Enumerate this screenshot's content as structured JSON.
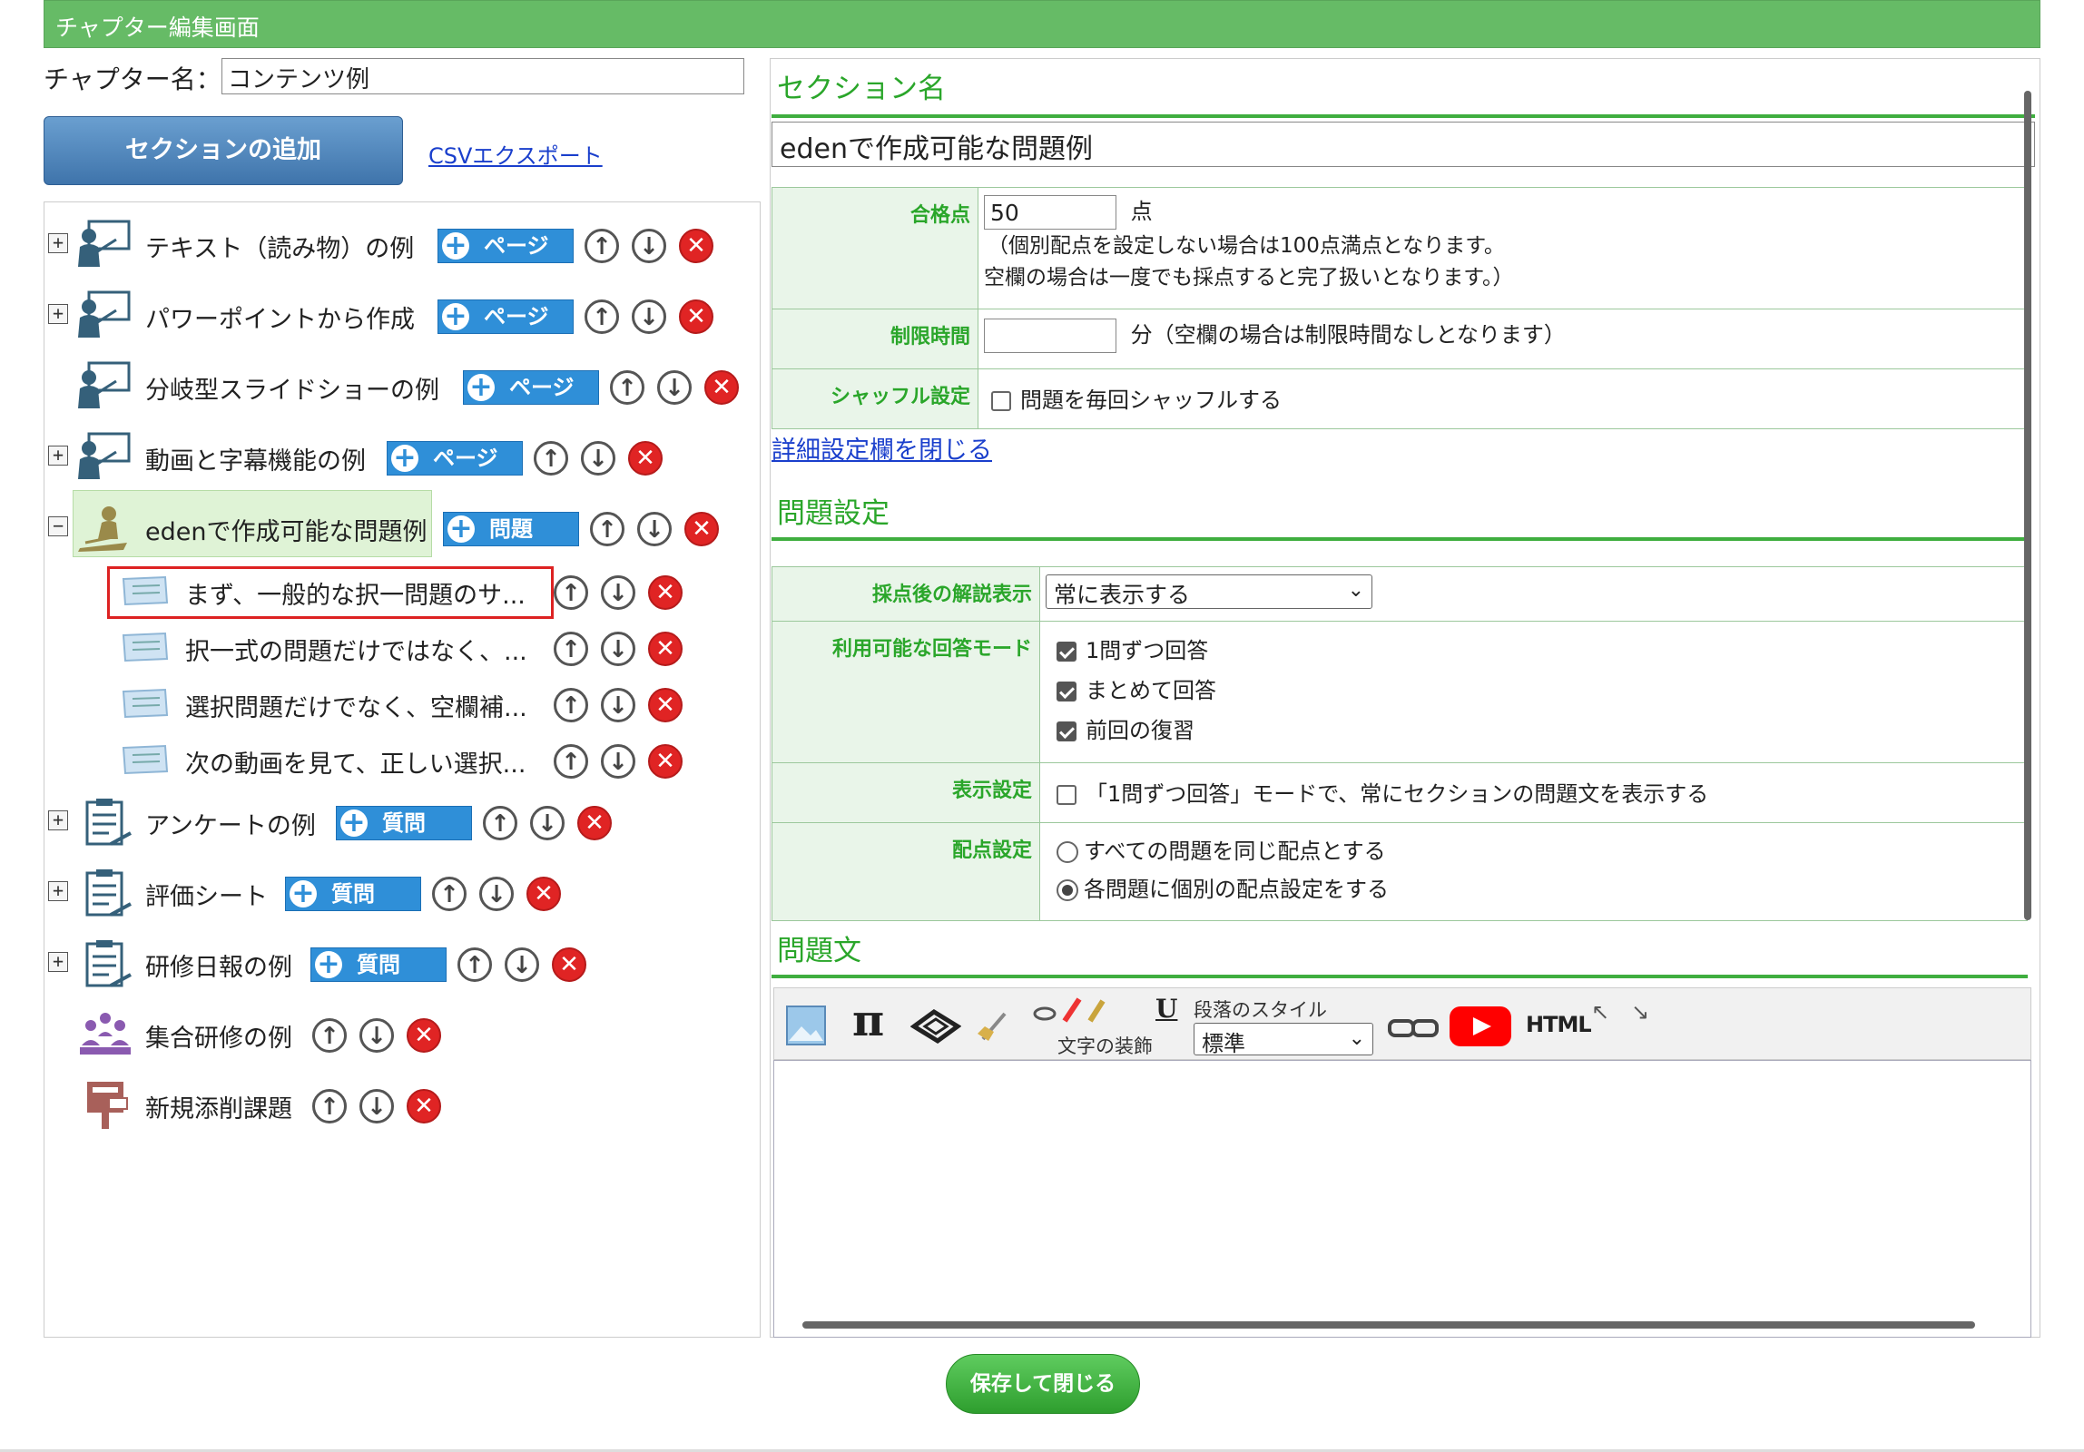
{
  "header": {
    "title": "チャプター編集画面"
  },
  "chapter": {
    "label": "チャプター名：",
    "value": "コンテンツ例"
  },
  "add_section_label": "セクションの追加",
  "csv_export_label": "CSVエクスポート",
  "tree": {
    "items": [
      {
        "label": "テキスト（読み物）の例",
        "button": "ページ"
      },
      {
        "label": "パワーポイントから作成",
        "button": "ページ"
      },
      {
        "label": "分岐型スライドショーの例",
        "button": "ページ"
      },
      {
        "label": "動画と字幕機能の例",
        "button": "ページ"
      },
      {
        "label": "edenで作成可能な問題例",
        "button": "問題"
      },
      {
        "label": "まず、一般的な択一問題のサ..."
      },
      {
        "label": "択一式の問題だけではなく、..."
      },
      {
        "label": "選択問題だけでなく、空欄補..."
      },
      {
        "label": "次の動画を見て、正しい選択..."
      },
      {
        "label": "アンケートの例",
        "button": "質問"
      },
      {
        "label": "評価シート",
        "button": "質問"
      },
      {
        "label": "研修日報の例",
        "button": "質問"
      },
      {
        "label": "集合研修の例"
      },
      {
        "label": "新規添削課題"
      }
    ],
    "expand_plus": "+",
    "expand_minus": "−",
    "plus_glyph": "+"
  },
  "right": {
    "section_name_title": "セクション名",
    "section_name_value": "edenで作成可能な問題例",
    "passing": {
      "label": "合格点",
      "value": "50",
      "unit": "点",
      "note1": "（個別配点を設定しない場合は100点満点となります。",
      "note2": "空欄の場合は一度でも採点すると完了扱いとなります。）"
    },
    "time_limit": {
      "label": "制限時間",
      "value": "",
      "note": "分（空欄の場合は制限時間なしとなります）"
    },
    "shuffle": {
      "label": "シャッフル設定",
      "option": "問題を毎回シャッフルする"
    },
    "detail_link": "詳細設定欄を閉じる",
    "question_settings_title": "問題設定",
    "explanation": {
      "label": "採点後の解説表示",
      "selected": "常に表示する"
    },
    "answer_modes": {
      "label": "利用可能な回答モード",
      "options": [
        "1問ずつ回答",
        "まとめて回答",
        "前回の復習"
      ]
    },
    "display": {
      "label": "表示設定",
      "option": "「1問ずつ回答」モードで、常にセクションの問題文を表示する"
    },
    "scoring": {
      "label": "配点設定",
      "options": [
        "すべての問題を同じ配点とする",
        "各問題に個別の配点設定をする"
      ]
    },
    "question_text_title": "問題文",
    "toolbar": {
      "pi": "π",
      "underline": "U",
      "decoration_label": "文字の装飾",
      "paragraph_label": "段落のスタイル",
      "paragraph_selected": "標準",
      "html": "HTML"
    }
  },
  "save_label": "保存して閉じる",
  "colors": {
    "header": "#66bb66",
    "accent_green": "#2aa62a",
    "pill_blue": "#2f8fd8",
    "delete_red": "#e02424"
  }
}
